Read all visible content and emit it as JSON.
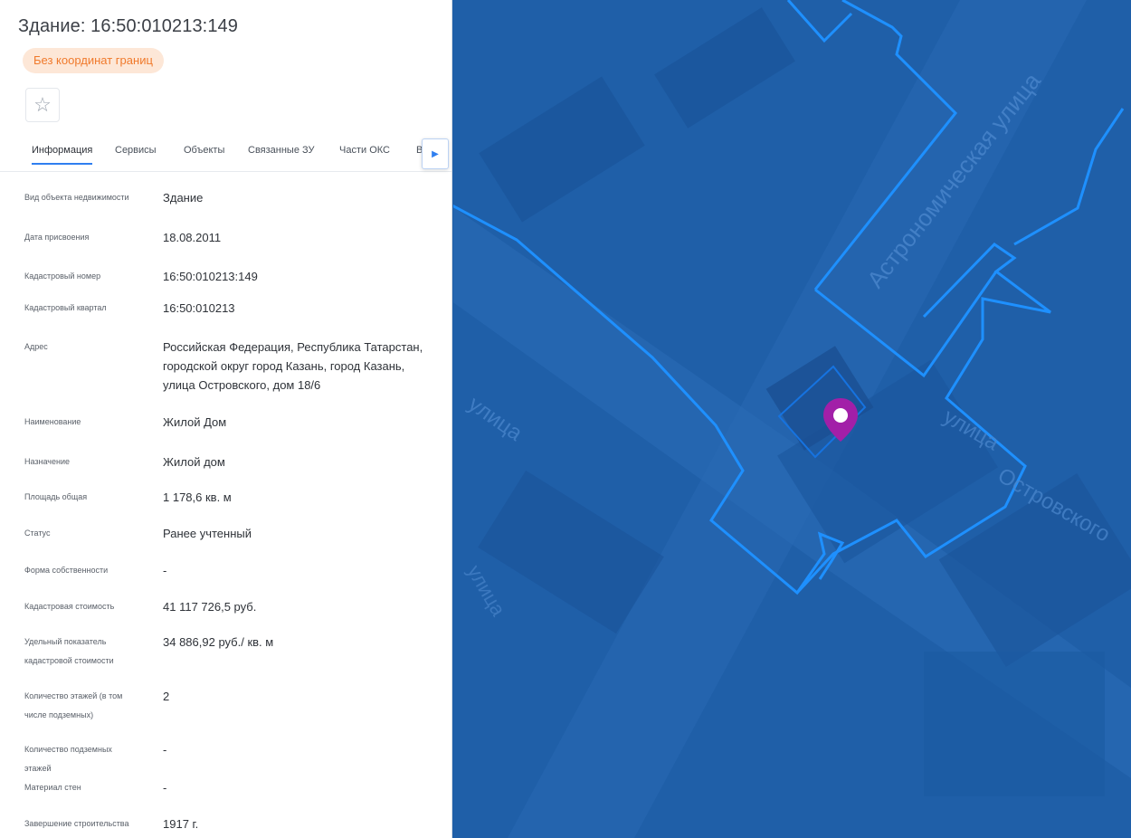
{
  "panel": {
    "title": "Здание: 16:50:010213:149",
    "badge": "Без координат границ",
    "favorite_icon": "star-outline-icon",
    "tabs": [
      {
        "label": "Информация",
        "active": true
      },
      {
        "label": "Сервисы",
        "active": false
      },
      {
        "label": "Объекты",
        "active": false
      },
      {
        "label": "Связанные ЗУ",
        "active": false
      },
      {
        "label": "Части ОКС",
        "active": false
      },
      {
        "label": "В",
        "active": false
      }
    ],
    "tabs_scroll_icon": "chevron-right-icon",
    "rows": [
      {
        "label": "Вид объекта недвижимости",
        "value": "Здание"
      },
      {
        "label": "Дата присвоения",
        "value": "18.08.2011"
      },
      {
        "label": "Кадастровый номер",
        "value": "16:50:010213:149"
      },
      {
        "label": "Кадастровый квартал",
        "value": "16:50:010213"
      },
      {
        "label": "Адрес",
        "value": "Российская Федерация, Республика Татарстан, городской округ город Казань, город Казань, улица Островского, дом 18/6"
      },
      {
        "label": "Наименование",
        "value": "Жилой Дом"
      },
      {
        "label": "Назначение",
        "value": "Жилой дом"
      },
      {
        "label": "Площадь общая",
        "value": "1 178,6 кв. м"
      },
      {
        "label": "Статус",
        "value": "Ранее учтенный"
      },
      {
        "label": "Форма собственности",
        "value": "-"
      },
      {
        "label": "Кадастровая стоимость",
        "value": "41 117 726,5 руб."
      },
      {
        "label": "Удельный показатель кадастровой стоимости",
        "value": "34 886,92 руб./ кв. м"
      },
      {
        "label": "Количество этажей (в том числе подземных)",
        "value": "2"
      },
      {
        "label": "Количество подземных этажей",
        "value": "-"
      },
      {
        "label": "Материал стен",
        "value": "-"
      },
      {
        "label": "Завершение строительства",
        "value": "1917 г."
      }
    ]
  },
  "map": {
    "street_labels": [
      "Астрономическая улица",
      "улица",
      "улица",
      "Островского",
      "улица"
    ],
    "marker_icon": "location-pin-icon",
    "colors": {
      "background": "#1f5fa8",
      "boundary": "#1e90ff",
      "marker": "#a21fa8"
    }
  }
}
